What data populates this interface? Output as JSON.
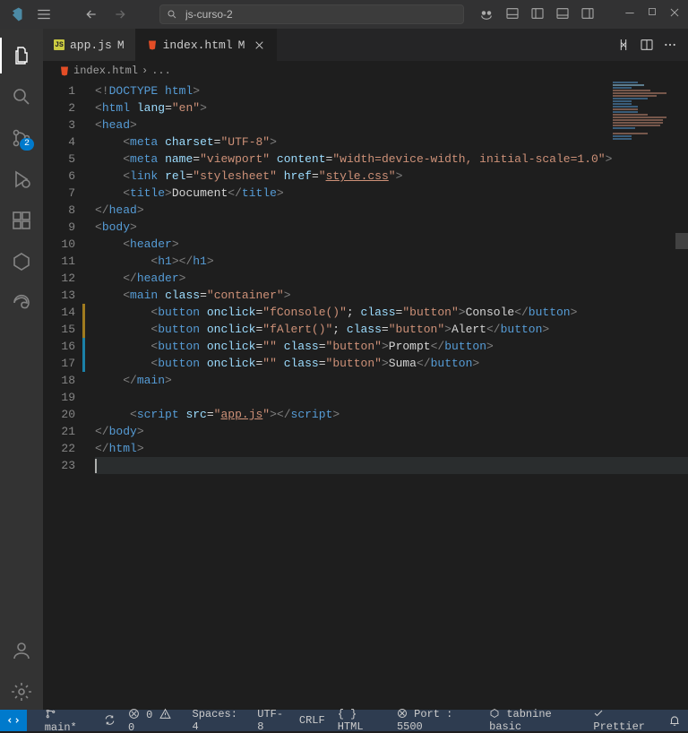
{
  "titlebar": {
    "search_value": "js-curso-2"
  },
  "activity": {
    "scm_badge": "2"
  },
  "tabs": [
    {
      "label": "app.js",
      "mod": "M",
      "icon": "js",
      "active": false
    },
    {
      "label": "index.html",
      "mod": "M",
      "icon": "html",
      "active": true,
      "close": true
    }
  ],
  "breadcrumb": {
    "file": "index.html",
    "sep": "›",
    "rest": "..."
  },
  "lineNumbers": [
    "1",
    "2",
    "3",
    "4",
    "5",
    "6",
    "7",
    "8",
    "9",
    "10",
    "11",
    "12",
    "13",
    "14",
    "15",
    "16",
    "17",
    "18",
    "19",
    "20",
    "21",
    "22",
    "23"
  ],
  "code": [
    [
      [
        "pnc",
        "<!"
      ],
      [
        "doc",
        "DOCTYPE"
      ],
      [
        "txt",
        " "
      ],
      [
        "doc",
        "html"
      ],
      [
        "pnc",
        ">"
      ]
    ],
    [
      [
        "pnc",
        "<"
      ],
      [
        "tag",
        "html"
      ],
      [
        "txt",
        " "
      ],
      [
        "attr",
        "lang"
      ],
      [
        "eq",
        "="
      ],
      [
        "str",
        "\"en\""
      ],
      [
        "pnc",
        ">"
      ]
    ],
    [
      [
        "pnc",
        "<"
      ],
      [
        "tag",
        "head"
      ],
      [
        "pnc",
        ">"
      ]
    ],
    [
      [
        "txt",
        "    "
      ],
      [
        "pnc",
        "<"
      ],
      [
        "tag",
        "meta"
      ],
      [
        "txt",
        " "
      ],
      [
        "attr",
        "charset"
      ],
      [
        "eq",
        "="
      ],
      [
        "str",
        "\"UTF-8\""
      ],
      [
        "pnc",
        ">"
      ]
    ],
    [
      [
        "txt",
        "    "
      ],
      [
        "pnc",
        "<"
      ],
      [
        "tag",
        "meta"
      ],
      [
        "txt",
        " "
      ],
      [
        "attr",
        "name"
      ],
      [
        "eq",
        "="
      ],
      [
        "str",
        "\"viewport\""
      ],
      [
        "txt",
        " "
      ],
      [
        "attr",
        "content"
      ],
      [
        "eq",
        "="
      ],
      [
        "str",
        "\"width=device-width, initial-scale=1.0\""
      ],
      [
        "pnc",
        ">"
      ]
    ],
    [
      [
        "txt",
        "    "
      ],
      [
        "pnc",
        "<"
      ],
      [
        "tag",
        "link"
      ],
      [
        "txt",
        " "
      ],
      [
        "attr",
        "rel"
      ],
      [
        "eq",
        "="
      ],
      [
        "str",
        "\"stylesheet\""
      ],
      [
        "txt",
        " "
      ],
      [
        "attr",
        "href"
      ],
      [
        "eq",
        "="
      ],
      [
        "str",
        "\""
      ],
      [
        "link",
        "style.css"
      ],
      [
        "str",
        "\""
      ],
      [
        "pnc",
        ">"
      ]
    ],
    [
      [
        "txt",
        "    "
      ],
      [
        "pnc",
        "<"
      ],
      [
        "tag",
        "title"
      ],
      [
        "pnc",
        ">"
      ],
      [
        "txt",
        "Document"
      ],
      [
        "pnc",
        "</"
      ],
      [
        "tag",
        "title"
      ],
      [
        "pnc",
        ">"
      ]
    ],
    [
      [
        "pnc",
        "</"
      ],
      [
        "tag",
        "head"
      ],
      [
        "pnc",
        ">"
      ]
    ],
    [
      [
        "pnc",
        "<"
      ],
      [
        "tag",
        "body"
      ],
      [
        "pnc",
        ">"
      ]
    ],
    [
      [
        "txt",
        "    "
      ],
      [
        "pnc",
        "<"
      ],
      [
        "tag",
        "header"
      ],
      [
        "pnc",
        ">"
      ]
    ],
    [
      [
        "txt",
        "        "
      ],
      [
        "pnc",
        "<"
      ],
      [
        "tag",
        "h1"
      ],
      [
        "pnc",
        "></"
      ],
      [
        "tag",
        "h1"
      ],
      [
        "pnc",
        ">"
      ]
    ],
    [
      [
        "txt",
        "    "
      ],
      [
        "pnc",
        "</"
      ],
      [
        "tag",
        "header"
      ],
      [
        "pnc",
        ">"
      ]
    ],
    [
      [
        "txt",
        "    "
      ],
      [
        "pnc",
        "<"
      ],
      [
        "tag",
        "main"
      ],
      [
        "txt",
        " "
      ],
      [
        "attr",
        "class"
      ],
      [
        "eq",
        "="
      ],
      [
        "str",
        "\"container\""
      ],
      [
        "pnc",
        ">"
      ]
    ],
    [
      [
        "txt",
        "        "
      ],
      [
        "pnc",
        "<"
      ],
      [
        "tag",
        "button"
      ],
      [
        "txt",
        " "
      ],
      [
        "attr",
        "onclick"
      ],
      [
        "eq",
        "="
      ],
      [
        "str",
        "\"fConsole()\""
      ],
      [
        "txt",
        "; "
      ],
      [
        "attr",
        "class"
      ],
      [
        "eq",
        "="
      ],
      [
        "str",
        "\"button\""
      ],
      [
        "pnc",
        ">"
      ],
      [
        "txt",
        "Console"
      ],
      [
        "pnc",
        "</"
      ],
      [
        "tag",
        "button"
      ],
      [
        "pnc",
        ">"
      ]
    ],
    [
      [
        "txt",
        "        "
      ],
      [
        "pnc",
        "<"
      ],
      [
        "tag",
        "button"
      ],
      [
        "txt",
        " "
      ],
      [
        "attr",
        "onclick"
      ],
      [
        "eq",
        "="
      ],
      [
        "str",
        "\"fAlert()\""
      ],
      [
        "txt",
        "; "
      ],
      [
        "attr",
        "class"
      ],
      [
        "eq",
        "="
      ],
      [
        "str",
        "\"button\""
      ],
      [
        "pnc",
        ">"
      ],
      [
        "txt",
        "Alert"
      ],
      [
        "pnc",
        "</"
      ],
      [
        "tag",
        "button"
      ],
      [
        "pnc",
        ">"
      ]
    ],
    [
      [
        "txt",
        "        "
      ],
      [
        "pnc",
        "<"
      ],
      [
        "tag",
        "button"
      ],
      [
        "txt",
        " "
      ],
      [
        "attr",
        "onclick"
      ],
      [
        "eq",
        "="
      ],
      [
        "str",
        "\"\""
      ],
      [
        "txt",
        " "
      ],
      [
        "attr",
        "class"
      ],
      [
        "eq",
        "="
      ],
      [
        "str",
        "\"button\""
      ],
      [
        "pnc",
        ">"
      ],
      [
        "txt",
        "Prompt"
      ],
      [
        "pnc",
        "</"
      ],
      [
        "tag",
        "button"
      ],
      [
        "pnc",
        ">"
      ]
    ],
    [
      [
        "txt",
        "        "
      ],
      [
        "pnc",
        "<"
      ],
      [
        "tag",
        "button"
      ],
      [
        "txt",
        " "
      ],
      [
        "attr",
        "onclick"
      ],
      [
        "eq",
        "="
      ],
      [
        "str",
        "\"\""
      ],
      [
        "txt",
        " "
      ],
      [
        "attr",
        "class"
      ],
      [
        "eq",
        "="
      ],
      [
        "str",
        "\"button\""
      ],
      [
        "pnc",
        ">"
      ],
      [
        "txt",
        "Suma"
      ],
      [
        "pnc",
        "</"
      ],
      [
        "tag",
        "button"
      ],
      [
        "pnc",
        ">"
      ]
    ],
    [
      [
        "txt",
        "    "
      ],
      [
        "pnc",
        "</"
      ],
      [
        "tag",
        "main"
      ],
      [
        "pnc",
        ">"
      ]
    ],
    [],
    [
      [
        "txt",
        "     "
      ],
      [
        "pnc",
        "<"
      ],
      [
        "tag",
        "script"
      ],
      [
        "txt",
        " "
      ],
      [
        "attr",
        "src"
      ],
      [
        "eq",
        "="
      ],
      [
        "str",
        "\""
      ],
      [
        "link",
        "app.js"
      ],
      [
        "str",
        "\""
      ],
      [
        "pnc",
        "></"
      ],
      [
        "tag",
        "script"
      ],
      [
        "pnc",
        ">"
      ]
    ],
    [
      [
        "pnc",
        "</"
      ],
      [
        "tag",
        "body"
      ],
      [
        "pnc",
        ">"
      ]
    ],
    [
      [
        "pnc",
        "</"
      ],
      [
        "tag",
        "html"
      ],
      [
        "pnc",
        ">"
      ]
    ],
    []
  ],
  "status": {
    "branch": "main*",
    "sync": "",
    "errors": "0",
    "warnings": "0",
    "spaces": "Spaces: 4",
    "encoding": "UTF-8",
    "eol": "CRLF",
    "lang": "HTML",
    "port": "Port : 5500",
    "tabnine": "tabnine basic",
    "prettier": "Prettier"
  }
}
